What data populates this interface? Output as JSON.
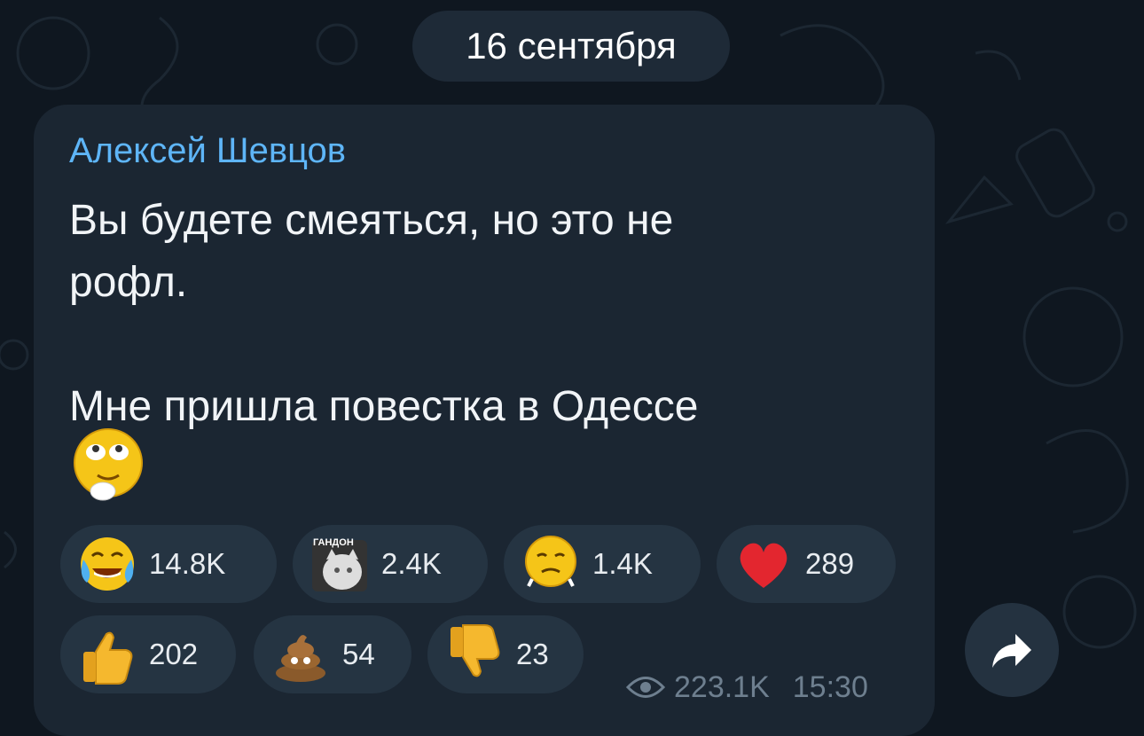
{
  "chat": {
    "date_separator": "16 сентября",
    "message": {
      "sender_name": "Алексей Шевцов",
      "lines": [
        "Вы будете смеяться, но это не",
        "рофл.",
        "",
        "Мне пришла повестка в Одессе"
      ],
      "trailing_emoji": "smiling-eyes-up-emoji",
      "reactions": [
        {
          "icon": "tears-of-joy-emoji",
          "count": "14.8K"
        },
        {
          "icon": "cat-sticker-emoji",
          "count": "2.4K",
          "sticker_text": "ГАНДОН"
        },
        {
          "icon": "sad-face-emoji",
          "count": "1.4K"
        },
        {
          "icon": "heart-emoji",
          "count": "289"
        },
        {
          "icon": "thumbs-up-emoji",
          "count": "202"
        },
        {
          "icon": "poop-emoji",
          "count": "54"
        },
        {
          "icon": "thumbs-down-emoji",
          "count": "23"
        }
      ],
      "views": "223.1K",
      "time": "15:30"
    },
    "share_icon": "share-arrow-icon",
    "colors": {
      "background": "#0f1720",
      "bubble": "#1b2632",
      "sender": "#5eb5f7",
      "reaction_pill": "#253442",
      "meta": "#6e7f8f"
    }
  }
}
